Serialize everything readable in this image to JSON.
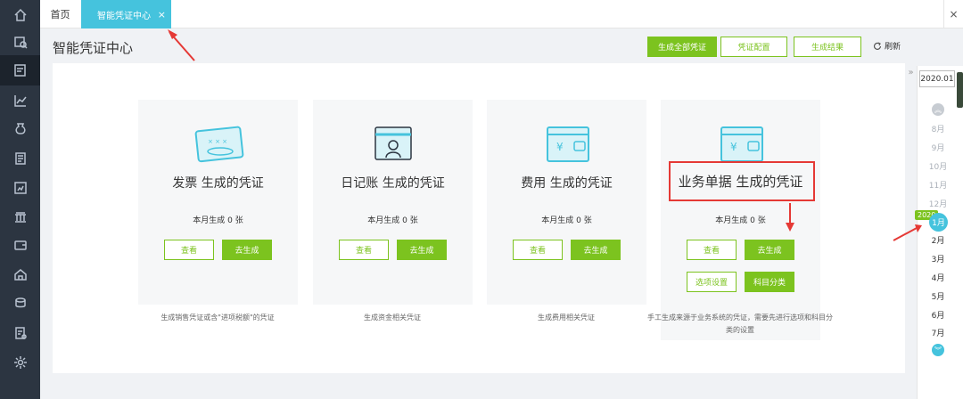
{
  "sidebar": {
    "items": [
      {
        "icon": "home-icon"
      },
      {
        "icon": "search-document-icon"
      },
      {
        "icon": "voucher-icon",
        "active": true
      },
      {
        "icon": "chart-icon"
      },
      {
        "icon": "money-bag-icon"
      },
      {
        "icon": "ledger-icon"
      },
      {
        "icon": "report-icon"
      },
      {
        "icon": "bank-icon"
      },
      {
        "icon": "wallet-icon"
      },
      {
        "icon": "building-icon"
      },
      {
        "icon": "coins-icon"
      },
      {
        "icon": "invoice-icon"
      },
      {
        "icon": "gear-icon"
      }
    ]
  },
  "tabs": {
    "home": "首页",
    "active": "智能凭证中心",
    "close": "×",
    "more": "×"
  },
  "header": {
    "title": "智能凭证中心",
    "btn_generate_all": "生成全部凭证",
    "btn_config": "凭证配置",
    "btn_result": "生成结果",
    "refresh": "刷新"
  },
  "cards": [
    {
      "title": "发票 生成的凭证",
      "count": "本月生成 0 张",
      "view": "查看",
      "go": "去生成",
      "desc": "生成销售凭证或含\"进项税额\"的凭证"
    },
    {
      "title": "日记账 生成的凭证",
      "count": "本月生成 0 张",
      "view": "查看",
      "go": "去生成",
      "desc": "生成资金相关凭证"
    },
    {
      "title": "费用 生成的凭证",
      "count": "本月生成 0 张",
      "view": "查看",
      "go": "去生成",
      "desc": "生成费用相关凭证"
    },
    {
      "title": "业务单据 生成的凭证",
      "count": "本月生成 0 张",
      "view": "查看",
      "go": "去生成",
      "options": "选项设置",
      "subjects": "科目分类",
      "desc": "手工生成来源于业务系统的凭证，需要先进行选项和科目分类的设置"
    }
  ],
  "period": {
    "year": "2020.01",
    "year_tag": "2020",
    "selected": "1月",
    "above": [
      "8月",
      "9月",
      "10月",
      "11月",
      "12月"
    ],
    "below": [
      "2月",
      "3月",
      "4月",
      "5月",
      "6月",
      "7月"
    ]
  },
  "colors": {
    "accent": "#45c3dd",
    "green": "#7cc31f",
    "annotation": "#e53935"
  }
}
